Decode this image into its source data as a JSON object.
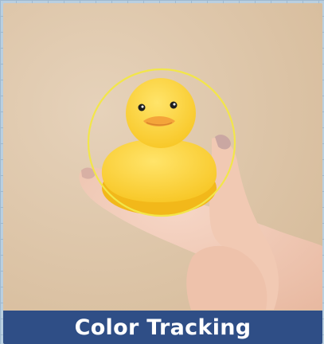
{
  "banner": {
    "title": "Color Tracking"
  },
  "colors": {
    "background_grid": "#b9cfe0",
    "banner_bg": "#2f4e86",
    "banner_text": "#ffffff",
    "tracking_circle": "#f2e64a",
    "duck_body": "#ffd93a",
    "duck_beak": "#f4a43a",
    "skin": "#f2c8b4"
  },
  "icons": {
    "target": "tracking-circle-icon",
    "object": "rubber-duck-icon"
  }
}
